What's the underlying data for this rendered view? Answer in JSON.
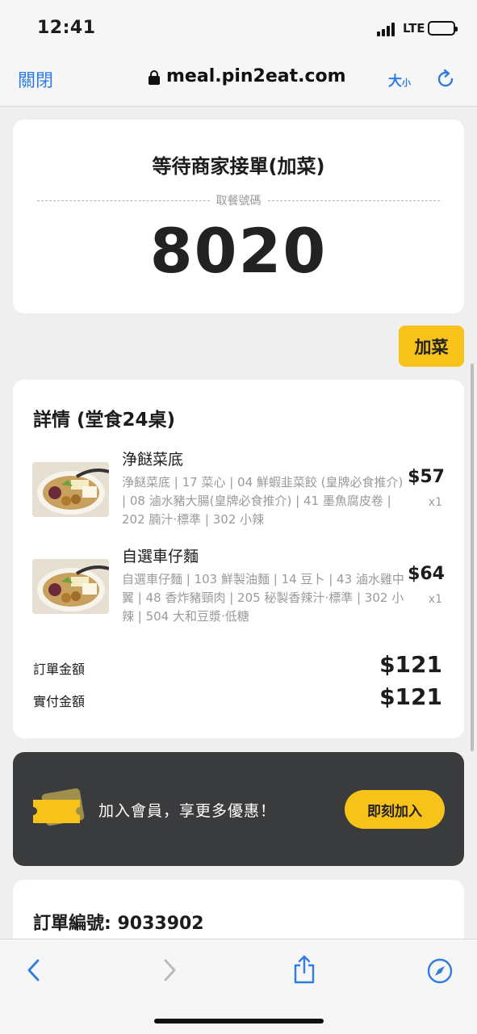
{
  "status_bar": {
    "time": "12:41",
    "network": "LTE"
  },
  "browser": {
    "close_label": "關閉",
    "url": "meal.pin2eat.com",
    "text_size_large": "大",
    "text_size_small": "小"
  },
  "order_status": {
    "title": "等待商家接單(加菜)",
    "pickup_label": "取餐號碼",
    "pickup_number": "8020"
  },
  "add_dish_label": "加菜",
  "details": {
    "title": "詳情 (堂食24桌)",
    "items": [
      {
        "name": "浄餸菜底",
        "description": "浄餸菜底 | 17 菜心 | 04 鮮蝦韭菜餃 (皇牌必食推介) | 08 滷水豬大腸(皇牌必食推介) | 41 墨魚腐皮卷 | 202 腩汁‧標準 | 302 小辣",
        "price": "$57",
        "qty": "x1"
      },
      {
        "name": "自選車仔麵",
        "description": "自選車仔麵 | 103 鮮製油麵 | 14 豆卜 | 43 滷水雞中翼 | 48 香炸豬頸肉 | 205 秘製香辣汁‧標準 | 302 小辣 | 504 大和豆漿‧低糖",
        "price": "$64",
        "qty": "x1"
      }
    ],
    "order_amount_label": "訂單金額",
    "order_amount": "$121",
    "paid_amount_label": "實付金額",
    "paid_amount": "$121"
  },
  "membership": {
    "text": "加入會員，享更多優惠！",
    "button": "即刻加入",
    "accent": "#f7c31a"
  },
  "order": {
    "number_text": "訂單編號: 9033902"
  },
  "toolbar": {
    "icons": [
      "back-icon",
      "forward-icon",
      "share-icon",
      "compass-icon"
    ]
  }
}
